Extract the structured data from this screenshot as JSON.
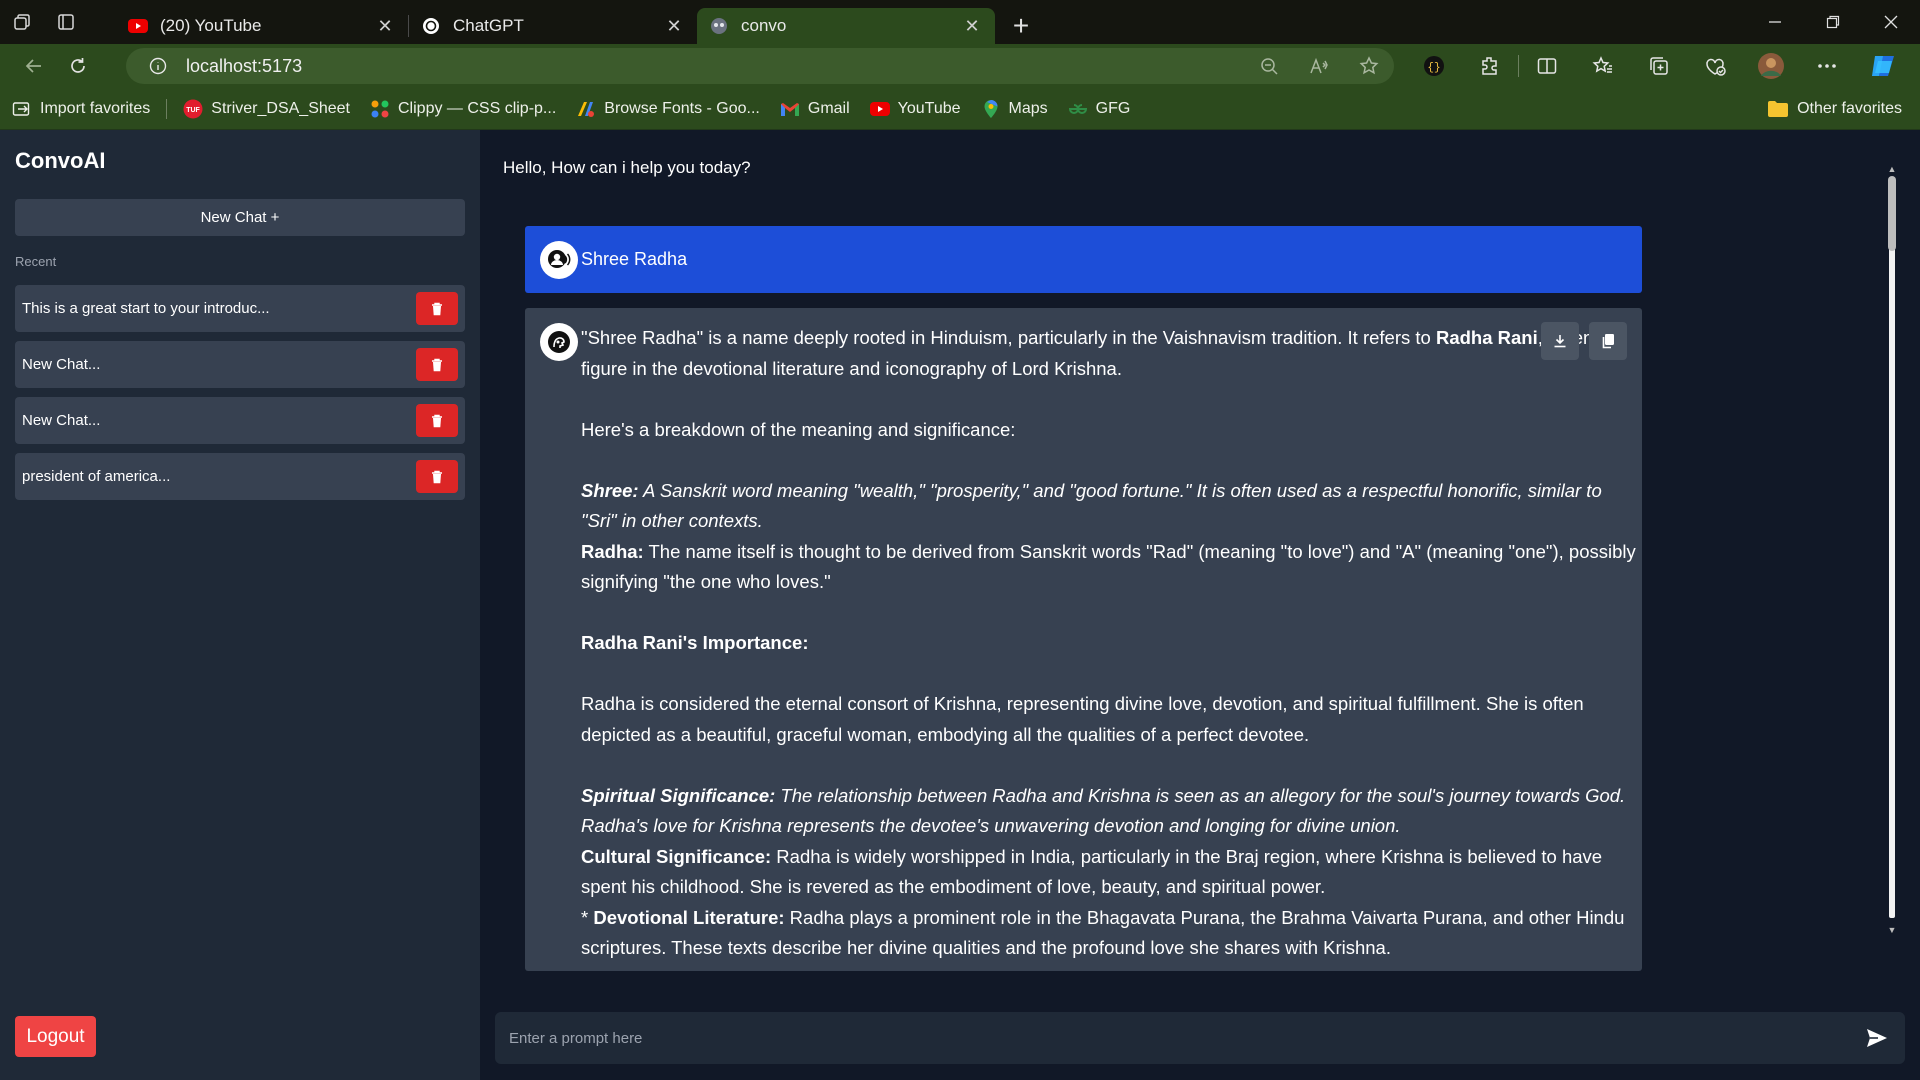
{
  "browser": {
    "tabs": [
      {
        "title": "(20) YouTube",
        "favicon": "youtube-icon",
        "active": false
      },
      {
        "title": "ChatGPT",
        "favicon": "chatgpt-icon",
        "active": false
      },
      {
        "title": "convo",
        "favicon": "convo-icon",
        "active": true
      }
    ],
    "url": "localhost:5173",
    "favorites": [
      {
        "label": "Import favorites",
        "icon": "import-icon"
      },
      {
        "label": "Striver_DSA_Sheet",
        "icon": "tuf-icon"
      },
      {
        "label": "Clippy — CSS clip-p...",
        "icon": "clippy-icon"
      },
      {
        "label": "Browse Fonts - Goo...",
        "icon": "google-fonts-icon"
      },
      {
        "label": "Gmail",
        "icon": "gmail-icon"
      },
      {
        "label": "YouTube",
        "icon": "youtube-icon"
      },
      {
        "label": "Maps",
        "icon": "maps-icon"
      },
      {
        "label": "GFG",
        "icon": "gfg-icon"
      }
    ],
    "other_favorites": "Other favorites"
  },
  "sidebar": {
    "brand": "ConvoAI",
    "new_chat": "New Chat +",
    "recent_label": "Recent",
    "chats": [
      "This is a great start to your introduc...",
      "New Chat...",
      "New Chat...",
      "president of america..."
    ],
    "logout": "Logout"
  },
  "main": {
    "greeting": "Hello, How can i help you today?",
    "user_message": "Shree Radha",
    "prompt_placeholder": "Enter a prompt here"
  },
  "response": {
    "p1_a": "\"Shree Radha\" is a name deeply rooted in Hinduism, particularly in the Vaishnavism tradition. It refers to ",
    "p1_b": "Radha Rani",
    "p1_c": ", a central figure in the devotional literature and iconography of Lord Krishna.",
    "p2": "Here's a breakdown of the meaning and significance:",
    "p3_label": "Shree:",
    "p3_text": " A Sanskrit word meaning \"wealth,\" \"prosperity,\" and \"good fortune.\" It is often used as a respectful honorific, similar to \"Sri\" in other contexts.",
    "p4_label": "Radha:",
    "p4_text": " The name itself is thought to be derived from Sanskrit words \"Rad\" (meaning \"to love\") and \"A\" (meaning \"one\"), possibly signifying \"the one who loves.\"",
    "p5": "Radha Rani's Importance:",
    "p6": "Radha is considered the eternal consort of Krishna, representing divine love, devotion, and spiritual fulfillment. She is often depicted as a beautiful, graceful woman, embodying all the qualities of a perfect devotee.",
    "p7_label": "Spiritual Significance:",
    "p7_text": " The relationship between Radha and Krishna is seen as an allegory for the soul's journey towards God. Radha's love for Krishna represents the devotee's unwavering devotion and longing for divine union.",
    "p8_label": "Cultural Significance:",
    "p8_text": " Radha is widely worshipped in India, particularly in the Braj region, where Krishna is believed to have spent his childhood. She is revered as the embodiment of love, beauty, and spiritual power.",
    "p9_prefix": "* ",
    "p9_label": "Devotional Literature:",
    "p9_text": " Radha plays a prominent role in the Bhagavata Purana, the Brahma Vaivarta Purana, and other Hindu scriptures. These texts describe her divine qualities and the profound love she shares with Krishna."
  },
  "colors": {
    "sidebar_bg": "#1f2937",
    "main_bg": "#111827",
    "user_bubble": "#1d4ed8",
    "bot_bubble": "#374151",
    "danger": "#dc2626",
    "browser_green": "#2c4a1d"
  }
}
